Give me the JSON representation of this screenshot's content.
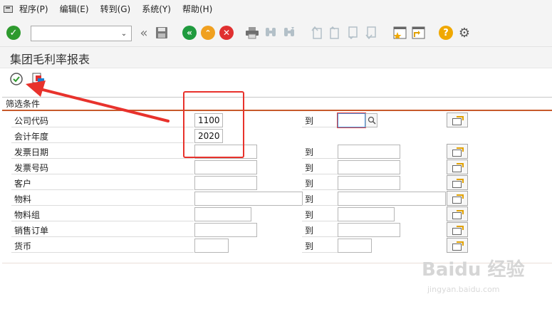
{
  "menu": [
    "程序(P)",
    "编辑(E)",
    "转到(G)",
    "系统(Y)",
    "帮助(H)"
  ],
  "toolbar": {
    "command_value": "",
    "icons": [
      "enter-icon",
      "back-double-icon",
      "save-icon",
      "back-icon",
      "exit-icon",
      "cancel-icon",
      "print-icon",
      "find-icon",
      "find-next-icon",
      "first-page-icon",
      "prev-page-icon",
      "next-page-icon",
      "last-page-icon",
      "new-session-icon",
      "shortcut-icon",
      "help-icon",
      "settings-icon"
    ]
  },
  "title": "集团毛利率报表",
  "group_title": "筛选条件",
  "rows": [
    {
      "label": "公司代码",
      "from": "1100",
      "to": ""
    },
    {
      "label": "会计年度",
      "from": "2020"
    },
    {
      "label": "发票日期",
      "from": "",
      "to": ""
    },
    {
      "label": "发票号码",
      "from": "",
      "to": ""
    },
    {
      "label": "客户",
      "from": "",
      "to": ""
    },
    {
      "label": "物料",
      "from": "",
      "to": ""
    },
    {
      "label": "物料组",
      "from": "",
      "to": ""
    },
    {
      "label": "销售订单",
      "from": "",
      "to": ""
    },
    {
      "label": "货币",
      "from": "",
      "to": ""
    }
  ],
  "to_label": "到",
  "watermark": "Baidu 经验",
  "watermark_sub": "jingyan.baidu.com",
  "colors": {
    "annotation": "#e8322c",
    "group_line": "#c75a2b",
    "enter": "#2e9a2e",
    "back": "#1f9a3e",
    "exit": "#f0a020",
    "cancel": "#e03030",
    "help": "#f0a800"
  }
}
